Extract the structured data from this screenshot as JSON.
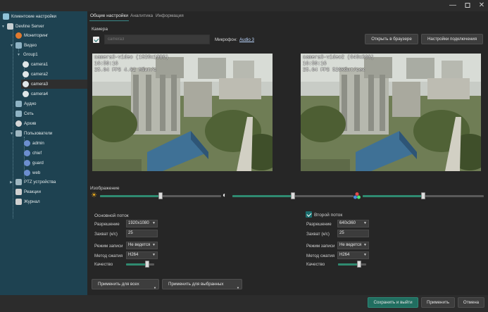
{
  "sidebar": {
    "items": [
      {
        "label": "Клиентские настройки",
        "icon": "monitor-icon",
        "color": "#8fc3d9"
      },
      {
        "label": "Devline Server",
        "icon": "server-icon",
        "color": "#c7cfd2"
      },
      {
        "label": "Мониторинг",
        "icon": "monitoring-icon",
        "color": "#e07a2f"
      },
      {
        "label": "Видео",
        "icon": "video-icon",
        "color": "#8fb3c4"
      },
      {
        "label": "Group1",
        "icon": "",
        "color": ""
      },
      {
        "label": "camera1",
        "icon": "camera-icon",
        "color": "#dfe6e8"
      },
      {
        "label": "camera2",
        "icon": "camera-icon",
        "color": "#dfe6e8"
      },
      {
        "label": "camera3",
        "icon": "camera-icon",
        "color": "#dfe6e8"
      },
      {
        "label": "camera4",
        "icon": "camera-icon",
        "color": "#dfe6e8"
      },
      {
        "label": "Аудио",
        "icon": "audio-icon",
        "color": "#8fb3c4"
      },
      {
        "label": "Сеть",
        "icon": "network-icon",
        "color": "#8fb3c4"
      },
      {
        "label": "Архив",
        "icon": "archive-icon",
        "color": "#d7d7d7"
      },
      {
        "label": "Пользователи",
        "icon": "users-icon",
        "color": "#9fb7c1"
      },
      {
        "label": "admin",
        "icon": "user-icon",
        "color": "#6c8ecf"
      },
      {
        "label": "chief",
        "icon": "user-icon",
        "color": "#6c8ecf"
      },
      {
        "label": "guard",
        "icon": "user-icon",
        "color": "#6c8ecf"
      },
      {
        "label": "web",
        "icon": "user-icon",
        "color": "#6c8ecf"
      },
      {
        "label": "PTZ устройства",
        "icon": "ptz-icon",
        "color": "#9fb7c1"
      },
      {
        "label": "Реакции",
        "icon": "reactions-icon",
        "color": "#d0d0d0"
      },
      {
        "label": "Журнал",
        "icon": "journal-icon",
        "color": "#d0d0d0"
      }
    ],
    "selected": "camera3"
  },
  "tabs": [
    "Общие настройки",
    "Аналитика",
    "Информация"
  ],
  "camera": {
    "section_label": "Камера",
    "enabled": true,
    "name_placeholder": "camera3",
    "mic_label": "Микрофон:",
    "mic_value": "Audio 3",
    "open_browser_label": "Открыть в браузере",
    "connection_settings_label": "Настройки подключения"
  },
  "streams": [
    {
      "title": "camera3-video (1920x1080)",
      "time": "16:59:16",
      "stats": "25.64 FPS 4.02 Мбит/с"
    },
    {
      "title": "camera3-video2 (640x360)",
      "time": "16:59:16",
      "stats": "25.64 FPS 526Кбит/сек"
    }
  ],
  "image": {
    "label": "Изображение",
    "brightness": 0.5,
    "contrast": 0.5,
    "saturation": 0.5
  },
  "main_stream": {
    "title": "Основной поток",
    "resolution_label": "Разрешение",
    "resolution": "1920x1080",
    "capture_label": "Захват (к/с)",
    "capture": "25",
    "record_label": "Режим записи",
    "record": "Не ведется",
    "codec_label": "Метод сжатия",
    "codec": "H264",
    "quality_label": "Качество",
    "quality": 0.75
  },
  "second_stream": {
    "enabled": true,
    "title": "Второй поток",
    "resolution_label": "Разрешение",
    "resolution": "640x360",
    "capture_label": "Захват (к/с)",
    "capture": "25",
    "record_label": "Режим записи",
    "record": "Не ведется",
    "codec_label": "Метод сжатия",
    "codec": "H264",
    "quality_label": "Качество",
    "quality": 0.75
  },
  "apply_all_label": "Применить для всех",
  "apply_selected_label": "Применить для выбранных",
  "footer": {
    "save_exit_label": "Сохранить и выйти",
    "apply_label": "Применить",
    "cancel_label": "Отмена"
  },
  "colors": {
    "accent": "#216e60",
    "sidebar_bg": "#1e4251",
    "slider_fill": "#2f8a70"
  }
}
